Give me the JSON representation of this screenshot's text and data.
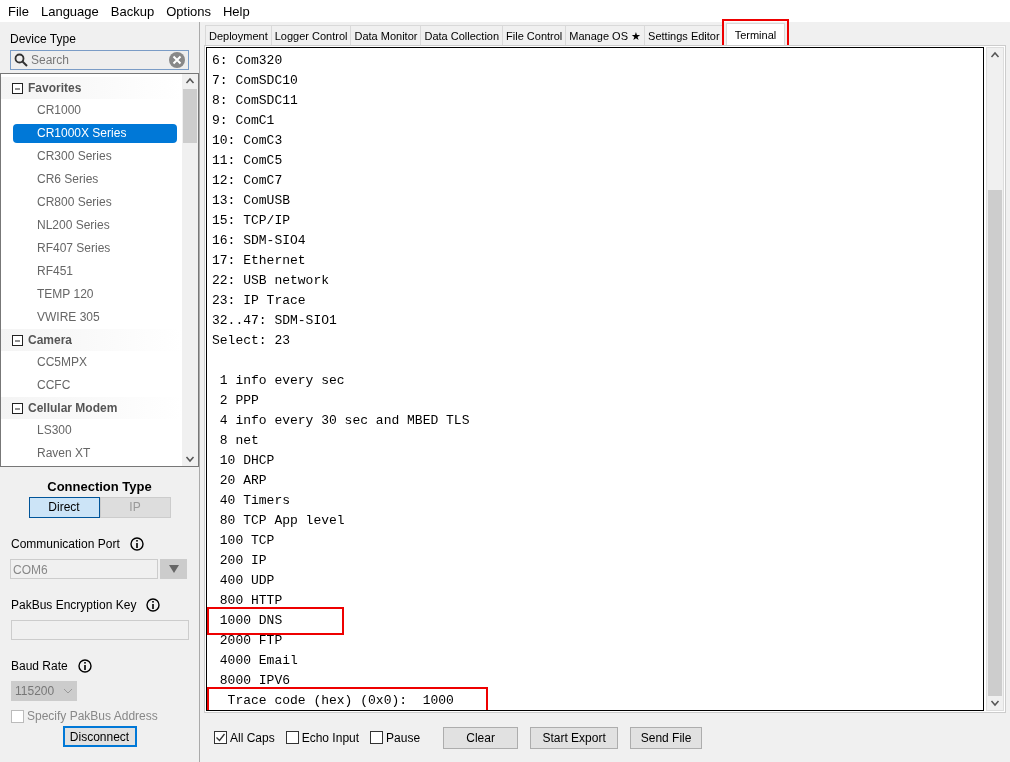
{
  "menu": [
    "File",
    "Language",
    "Backup",
    "Options",
    "Help"
  ],
  "sidebar": {
    "device_type_label": "Device Type",
    "search": {
      "placeholder": "Search"
    },
    "tree": [
      {
        "label": "Favorites",
        "expanded": true,
        "children": [
          {
            "label": "CR1000",
            "selected": false
          },
          {
            "label": "CR1000X Series",
            "selected": true
          },
          {
            "label": "CR300 Series",
            "selected": false
          },
          {
            "label": "CR6 Series",
            "selected": false
          },
          {
            "label": "CR800 Series",
            "selected": false
          },
          {
            "label": "NL200 Series",
            "selected": false
          },
          {
            "label": "RF407 Series",
            "selected": false
          },
          {
            "label": "RF451",
            "selected": false
          },
          {
            "label": "TEMP 120",
            "selected": false
          },
          {
            "label": "VWIRE 305",
            "selected": false
          }
        ]
      },
      {
        "label": "Camera",
        "expanded": true,
        "children": [
          {
            "label": "CC5MPX",
            "selected": false
          },
          {
            "label": "CCFC",
            "selected": false
          }
        ]
      },
      {
        "label": "Cellular Modem",
        "expanded": true,
        "children": [
          {
            "label": "LS300",
            "selected": false
          },
          {
            "label": "Raven XT",
            "selected": false
          }
        ]
      }
    ],
    "connection": {
      "title": "Connection Type",
      "types": [
        {
          "label": "Direct",
          "selected": true
        },
        {
          "label": "IP",
          "selected": false
        }
      ],
      "port_label": "Communication Port",
      "port_value": "COM6",
      "encryption_label": "PakBus Encryption Key",
      "baud_label": "Baud Rate",
      "baud_value": "115200",
      "specify_address": {
        "label": "Specify PakBus Address",
        "checked": false,
        "disabled": true
      },
      "disconnect": "Disconnect"
    }
  },
  "tabs": [
    {
      "label": "Deployment",
      "selected": false,
      "highlighted": false
    },
    {
      "label": "Logger Control",
      "selected": false,
      "highlighted": false
    },
    {
      "label": "Data Monitor",
      "selected": false,
      "highlighted": false
    },
    {
      "label": "Data Collection",
      "selected": false,
      "highlighted": false
    },
    {
      "label": "File Control",
      "selected": false,
      "highlighted": false
    },
    {
      "label": "Manage OS ★",
      "selected": false,
      "highlighted": false
    },
    {
      "label": "Settings Editor",
      "selected": false,
      "highlighted": false
    },
    {
      "label": "Terminal",
      "selected": true,
      "highlighted": true
    }
  ],
  "terminal": {
    "port_lines": [
      {
        "text": "6: Com320",
        "highlighted": false
      },
      {
        "text": "7: ComSDC10",
        "highlighted": false
      },
      {
        "text": "8: ComSDC11",
        "highlighted": false
      },
      {
        "text": "9: ComC1",
        "highlighted": false
      },
      {
        "text": "10: ComC3",
        "highlighted": false
      },
      {
        "text": "11: ComC5",
        "highlighted": false
      },
      {
        "text": "12: ComC7",
        "highlighted": false
      },
      {
        "text": "13: ComUSB",
        "highlighted": false
      },
      {
        "text": "15: TCP/IP",
        "highlighted": false
      },
      {
        "text": "16: SDM-SIO4",
        "highlighted": false
      },
      {
        "text": "17: Ethernet",
        "highlighted": false
      },
      {
        "text": "22: USB network",
        "highlighted": false
      },
      {
        "text": "23: IP Trace",
        "highlighted": false
      },
      {
        "text": "32..47: SDM-SIO1",
        "highlighted": false
      },
      {
        "text": "Select: 23",
        "highlighted": false
      }
    ],
    "trace_lines": [
      {
        "text": " 1 info every sec",
        "highlighted": false
      },
      {
        "text": " 2 PPP",
        "highlighted": false
      },
      {
        "text": " 4 info every 30 sec and MBED TLS",
        "highlighted": false
      },
      {
        "text": " 8 net",
        "highlighted": false
      },
      {
        "text": " 10 DHCP",
        "highlighted": false
      },
      {
        "text": " 20 ARP",
        "highlighted": false
      },
      {
        "text": " 40 Timers",
        "highlighted": false
      },
      {
        "text": " 80 TCP App level",
        "highlighted": false
      },
      {
        "text": " 100 TCP",
        "highlighted": false
      },
      {
        "text": " 200 IP",
        "highlighted": false
      },
      {
        "text": " 400 UDP",
        "highlighted": false
      },
      {
        "text": " 800 HTTP",
        "highlighted": false
      },
      {
        "text": " 1000 DNS",
        "highlighted": true
      },
      {
        "text": " 2000 FTP",
        "highlighted": false
      },
      {
        "text": " 4000 Email",
        "highlighted": false
      },
      {
        "text": " 8000 IPV6",
        "highlighted": false
      },
      {
        "text": "  Trace code (hex) (0x0):  1000",
        "highlighted": true
      }
    ],
    "options": [
      {
        "label": "All Caps",
        "checked": true
      },
      {
        "label": "Echo Input",
        "checked": false
      },
      {
        "label": "Pause",
        "checked": false
      }
    ],
    "buttons": [
      "Clear",
      "Start Export",
      "Send File"
    ]
  }
}
